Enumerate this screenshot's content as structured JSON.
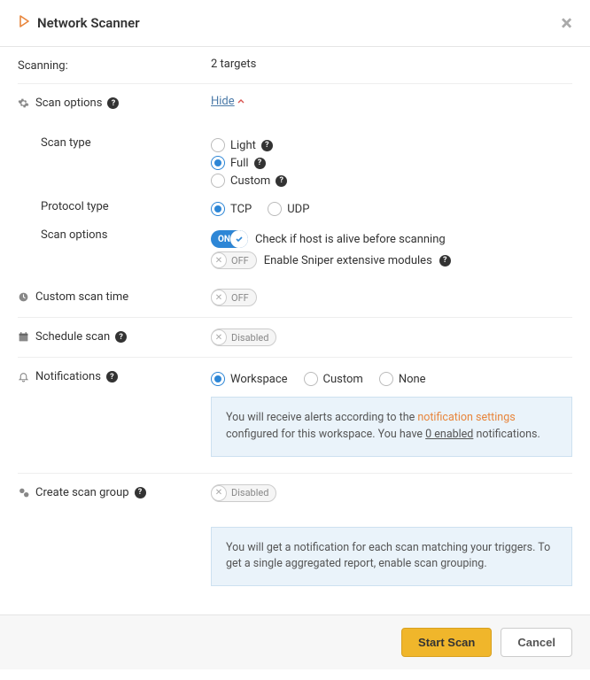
{
  "header": {
    "title": "Network Scanner"
  },
  "scanning": {
    "label": "Scanning:",
    "value": "2 targets"
  },
  "scan_options_section": {
    "label": "Scan options",
    "toggle": "Hide"
  },
  "scan_type": {
    "label": "Scan type",
    "options": {
      "light": "Light",
      "full": "Full",
      "custom": "Custom"
    }
  },
  "protocol": {
    "label": "Protocol type",
    "options": {
      "tcp": "TCP",
      "udp": "UDP"
    }
  },
  "scan_opts": {
    "label": "Scan options",
    "alive": "Check if host is alive before scanning",
    "sniper": "Enable Sniper extensive modules",
    "on": "ON",
    "off": "OFF"
  },
  "custom_time": {
    "label": "Custom scan time",
    "pill": "OFF"
  },
  "schedule": {
    "label": "Schedule scan",
    "pill": "Disabled"
  },
  "notifications": {
    "label": "Notifications",
    "options": {
      "workspace": "Workspace",
      "custom": "Custom",
      "none": "None"
    },
    "alert_pre": "You will receive alerts according to the ",
    "alert_link": "notification settings",
    "alert_mid": " configured for this workspace. You have ",
    "alert_count": "0 enabled",
    "alert_suf": " notifications."
  },
  "scan_group": {
    "label": "Create scan group",
    "pill": "Disabled",
    "alert": "You will get a notification for each scan matching your triggers. To get a single aggregated report, enable scan grouping."
  },
  "footer": {
    "start": "Start Scan",
    "cancel": "Cancel"
  }
}
